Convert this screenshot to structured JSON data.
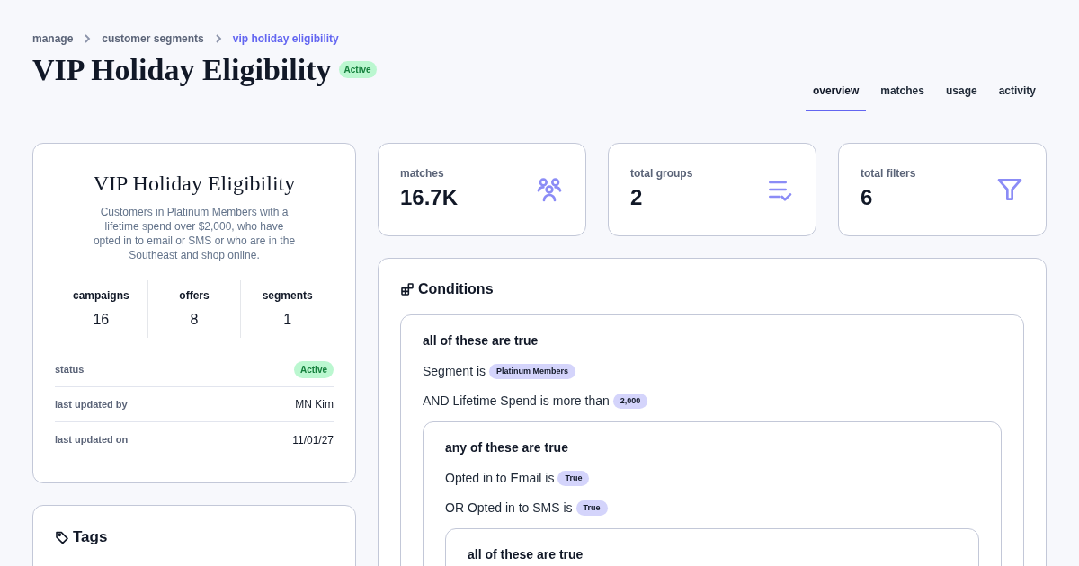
{
  "breadcrumb": [
    {
      "label": "manage",
      "current": false
    },
    {
      "label": "customer segments",
      "current": false
    },
    {
      "label": "vip holiday eligibility",
      "current": true
    }
  ],
  "title": "VIP Holiday Eligibility",
  "status_badge": "Active",
  "tabs": [
    {
      "label": "overview",
      "selected": true
    },
    {
      "label": "matches",
      "selected": false
    },
    {
      "label": "usage",
      "selected": false
    },
    {
      "label": "activity",
      "selected": false
    }
  ],
  "summary": {
    "title": "VIP Holiday Eligibility",
    "description": "Customers in Platinum Members with a lifetime spend over $2,000, who have opted in to email or SMS or who are in the Southeast and shop online.",
    "counts": [
      {
        "label": "campaigns",
        "value": "16"
      },
      {
        "label": "offers",
        "value": "8"
      },
      {
        "label": "segments",
        "value": "1"
      }
    ],
    "details": [
      {
        "kind": "badge",
        "label": "status",
        "value": "Active"
      },
      {
        "kind": "text",
        "label": "last updated by",
        "value": "MN Kim"
      },
      {
        "kind": "text",
        "label": "last updated on",
        "value": "11/01/27"
      }
    ]
  },
  "tags": {
    "title": "Tags"
  },
  "stats": [
    {
      "kind": "users",
      "label": "matches",
      "value": "16.7K"
    },
    {
      "kind": "list",
      "label": "total groups",
      "value": "2"
    },
    {
      "kind": "filter",
      "label": "total filters",
      "value": "6"
    }
  ],
  "conditions": {
    "title": "Conditions",
    "group": {
      "heading": "all of these are true",
      "rules": [
        {
          "text": "Segment is",
          "value": "Platinum Members"
        },
        {
          "text": "AND Lifetime Spend is more than",
          "value": "2,000"
        }
      ],
      "groups": [
        {
          "heading": "any of these are true",
          "rules": [
            {
              "text": "Opted in to Email is",
              "value": "True"
            },
            {
              "text": "OR Opted in to SMS is",
              "value": "True"
            }
          ],
          "groups": [
            {
              "heading": "all of these are true"
            }
          ]
        }
      ]
    }
  }
}
